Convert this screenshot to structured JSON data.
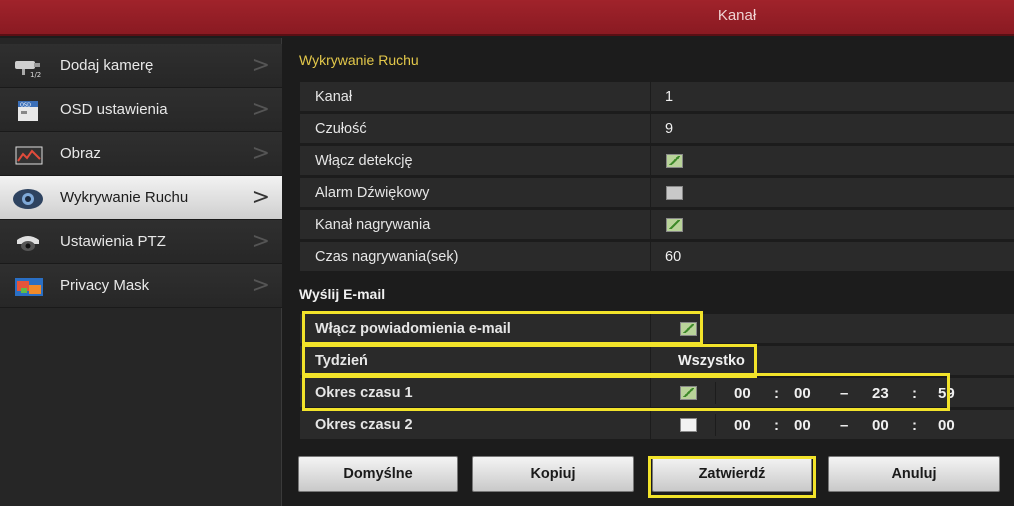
{
  "window": {
    "title": "Kanał"
  },
  "sidebar": {
    "items": [
      {
        "label": "Dodaj kamerę",
        "icon": "camera-icon"
      },
      {
        "label": "OSD ustawienia",
        "icon": "osd-icon"
      },
      {
        "label": "Obraz",
        "icon": "image-icon"
      },
      {
        "label": "Wykrywanie Ruchu",
        "icon": "motion-icon",
        "active": true
      },
      {
        "label": "Ustawienia PTZ",
        "icon": "ptz-icon"
      },
      {
        "label": "Privacy Mask",
        "icon": "privacy-mask-icon"
      }
    ],
    "chevron": ">"
  },
  "motion": {
    "section_title": "Wykrywanie Ruchu",
    "rows": [
      {
        "label": "Kanał",
        "value": "1"
      },
      {
        "label": "Czułość",
        "value": "9"
      },
      {
        "label": "Włącz detekcję",
        "checked": true
      },
      {
        "label": "Alarm Dźwiękowy",
        "checked": false
      },
      {
        "label": "Kanał nagrywania",
        "checked": true
      },
      {
        "label": "Czas nagrywania(sek)",
        "value": "60"
      }
    ]
  },
  "email": {
    "section_title": "Wyślij E-mail",
    "enable_label": "Włącz powiadomienia e-mail",
    "enable_checked": true,
    "week_label": "Tydzień",
    "week_value": "Wszystko",
    "period1": {
      "label": "Okres czasu 1",
      "checked": true,
      "h1": "00",
      "m1": "00",
      "h2": "23",
      "m2": "59"
    },
    "period2": {
      "label": "Okres czasu 2",
      "checked": false,
      "h1": "00",
      "m1": "00",
      "h2": "00",
      "m2": "00"
    },
    "sep_colon": ":",
    "sep_dash": "–"
  },
  "buttons": {
    "default": "Domyślne",
    "copy": "Kopiuj",
    "confirm": "Zatwierdź",
    "cancel": "Anuluj"
  },
  "colors": {
    "title_bar": "#9a2129",
    "highlight": "#f2e32a",
    "section_title": "#e3c84a"
  }
}
